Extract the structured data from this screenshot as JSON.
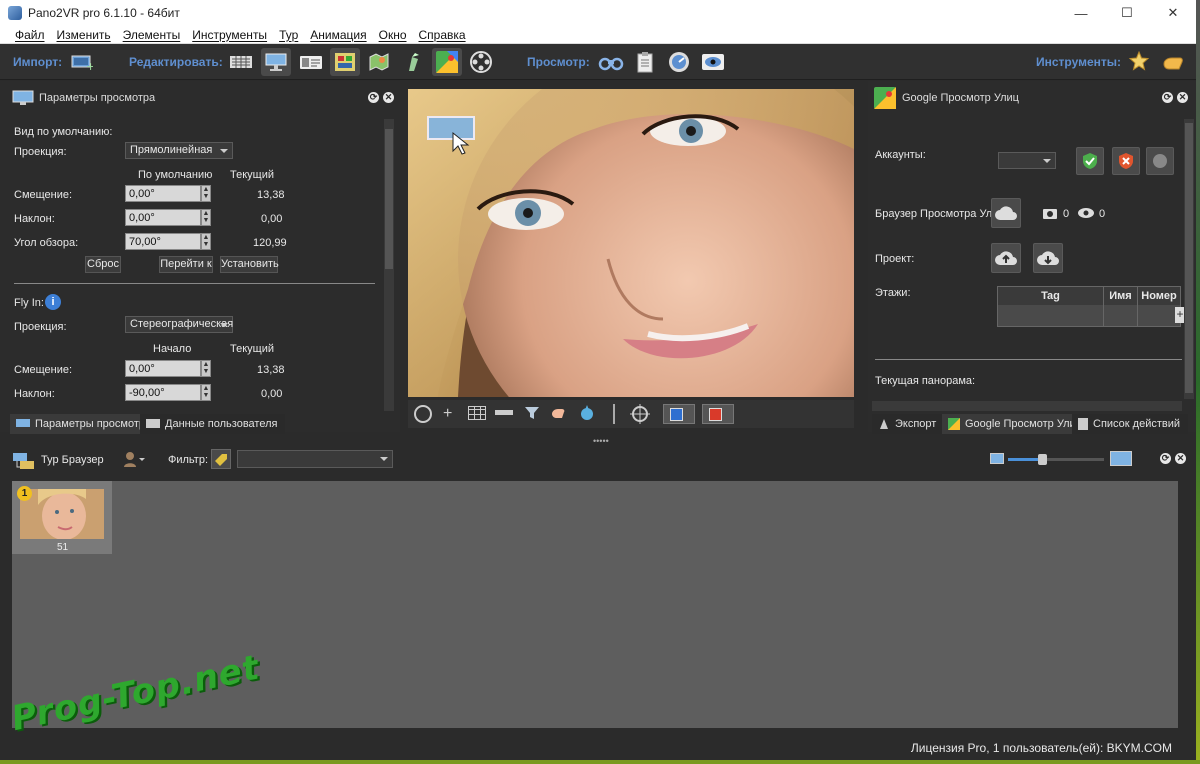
{
  "window": {
    "title": "Pano2VR pro 6.1.10 - 64бит",
    "min": "—",
    "max": "☐",
    "close": "✕"
  },
  "menu": [
    "Файл",
    "Изменить",
    "Элементы",
    "Инструменты",
    "Тур",
    "Анимация",
    "Окно",
    "Справка"
  ],
  "toolbar": {
    "import_label": "Импорт:",
    "edit_label": "Редактировать:",
    "view_label": "Просмотр:",
    "tools_label": "Инструменты:"
  },
  "viewing_params": {
    "title": "Параметры просмотра",
    "default_view_label": "Вид по умолчанию:",
    "projection_label": "Проекция:",
    "projection_value": "Прямолинейная",
    "col_default": "По умолчанию",
    "col_current": "Текущий",
    "pan_label": "Смещение:",
    "pan_value": "0,00°",
    "pan_current": "13,38",
    "tilt_label": "Наклон:",
    "tilt_value": "0,00°",
    "tilt_current": "0,00",
    "fov_label": "Угол обзора:",
    "fov_value": "70,00°",
    "fov_current": "120,99",
    "reset_btn": "Сброс",
    "goto_btn": "Перейти к",
    "set_btn": "Установить",
    "flyin_label": "Fly In:",
    "flyin_projection_label": "Проекция:",
    "flyin_projection_value": "Стереографическая",
    "col_start": "Начало",
    "col_current2": "Текущий",
    "flyin_pan_label": "Смещение:",
    "flyin_pan_value": "0,00°",
    "flyin_pan_current": "13,38",
    "flyin_tilt_label": "Наклон:",
    "flyin_tilt_value": "-90,00°",
    "flyin_tilt_current": "0,00"
  },
  "left_tabs": {
    "tab1": "Параметры просмотра",
    "tab2": "Данные пользователя"
  },
  "street_view": {
    "title": "Google Просмотр Улиц",
    "accounts_label": "Аккаунты:",
    "browser_label": "Браузер Просмотра Улиц:",
    "photo_count": "0",
    "view_count": "0",
    "project_label": "Проект:",
    "floors_label": "Этажи:",
    "table_headers": [
      "Tag",
      "Имя",
      "Номер"
    ],
    "current_pano_label": "Текущая панорама:"
  },
  "right_tabs": {
    "tab1": "Экспорт",
    "tab2": "Google Просмотр Улиц",
    "tab3": "Список действий"
  },
  "tour_browser": {
    "title": "Тур Браузер",
    "filter_label": "Фильтр:",
    "filter_value": "",
    "thumb_badge": "1",
    "thumb_caption": "51"
  },
  "status": {
    "license": "Лицензия Pro, 1 пользователь(ей): BKYM.COM"
  },
  "watermark": "Prog-Top.net"
}
